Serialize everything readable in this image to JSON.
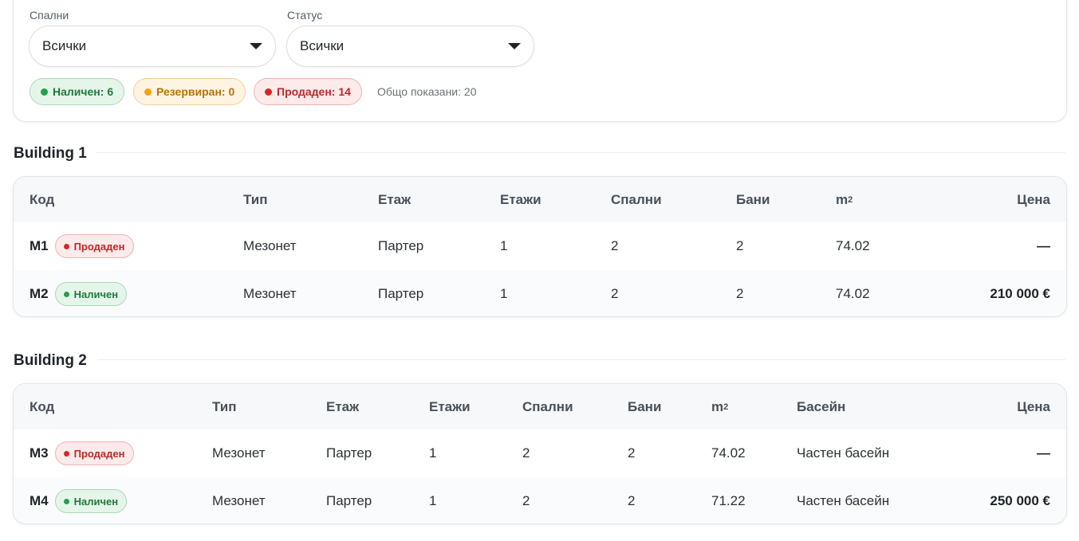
{
  "filters": {
    "bedrooms": {
      "label": "Спални",
      "value": "Всички"
    },
    "status": {
      "label": "Статус",
      "value": "Всички"
    }
  },
  "summary": {
    "available": "Наличен: 6",
    "reserved": "Резервиран: 0",
    "sold": "Продаден: 14",
    "total": "Общо показани: 20"
  },
  "colors": {
    "available": "#22a04a",
    "reserved": "#f5a214",
    "sold": "#d62828"
  },
  "buildings": [
    {
      "title": "Building 1",
      "headers": {
        "code": "Код",
        "type": "Тип",
        "floor": "Етаж",
        "floors": "Етажи",
        "bedrooms": "Спални",
        "baths": "Бани",
        "area": "m",
        "area_sup": "2",
        "price": "Цена"
      },
      "rows": [
        {
          "code": "M1",
          "status": "Продаден",
          "status_kind": "sold",
          "type": "Мезонет",
          "floor": "Партер",
          "floors": "1",
          "bedrooms": "2",
          "baths": "2",
          "area": "74.02",
          "price": "—"
        },
        {
          "code": "M2",
          "status": "Наличен",
          "status_kind": "available",
          "type": "Мезонет",
          "floor": "Партер",
          "floors": "1",
          "bedrooms": "2",
          "baths": "2",
          "area": "74.02",
          "price": "210 000 €"
        }
      ]
    },
    {
      "title": "Building 2",
      "headers": {
        "code": "Код",
        "type": "Тип",
        "floor": "Етаж",
        "floors": "Етажи",
        "bedrooms": "Спални",
        "baths": "Бани",
        "area": "m",
        "area_sup": "2",
        "pool": "Басейн",
        "price": "Цена"
      },
      "rows": [
        {
          "code": "M3",
          "status": "Продаден",
          "status_kind": "sold",
          "type": "Мезонет",
          "floor": "Партер",
          "floors": "1",
          "bedrooms": "2",
          "baths": "2",
          "area": "74.02",
          "pool": "Частен басейн",
          "price": "—"
        },
        {
          "code": "M4",
          "status": "Наличен",
          "status_kind": "available",
          "type": "Мезонет",
          "floor": "Партер",
          "floors": "1",
          "bedrooms": "2",
          "baths": "2",
          "area": "71.22",
          "pool": "Частен басейн",
          "price": "250 000 €"
        }
      ]
    }
  ]
}
